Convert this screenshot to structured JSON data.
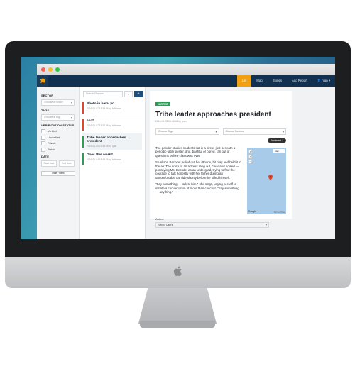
{
  "window": {
    "controls": [
      "close",
      "minimize",
      "zoom"
    ]
  },
  "navbar": {
    "logo_icon": "tree-logo-icon",
    "items": [
      {
        "label": "List",
        "active": true
      },
      {
        "label": "Map",
        "active": false
      },
      {
        "label": "Stories",
        "active": false
      },
      {
        "label": "Add Report",
        "active": false
      },
      {
        "label": "ryan",
        "active": false,
        "icon": "user-icon"
      }
    ]
  },
  "filters": {
    "sector_label": "SECTOR",
    "sector_placeholder": "Choose a Sector",
    "tags_label": "TAGS",
    "tags_placeholder": "Choose a Tag",
    "verification_label": "VERIFICATION STATUS",
    "statuses": [
      "Verified",
      "Unverified",
      "Private",
      "Public"
    ],
    "date_label": "DATE",
    "start_date": "Start date",
    "end_date": "End date",
    "hide_filters": "Hide Filters"
  },
  "reports": {
    "search_placeholder": "Search Reports",
    "add_label": "+",
    "items": [
      {
        "title": "Photo in here, yo",
        "meta": "2016-01-07 15:33:06 by lvilbowaz",
        "color": "#e0462f"
      },
      {
        "title": "asdf",
        "meta": "2016-01-07 15:32:06 by lvilbowaz",
        "color": "#e0462f"
      },
      {
        "title": "Tribe leader approaches president",
        "meta": "2016-01-05 21:48:48 by ryan",
        "color": "#2e9b58"
      },
      {
        "title": "Does this work?",
        "meta": "2016-01-04 18:45:16 by lvilbowaz",
        "color": "#2e9b58"
      }
    ]
  },
  "detail": {
    "status": "Verified",
    "title": "Tribe leader approaches president",
    "meta": "2016-01-05 21:48:48 by ryan",
    "tag_placeholder": "Choose Tags",
    "sector_placeholder": "Choose Sectors",
    "sentiment": "Sentiment 1",
    "paragraphs": [
      "The gender studies students sat in a circle, just beneath a periodic-table poster, and, bashful or bored, ran out of questions before class was over.",
      "So Alison Bechdel pulled out her iPhone, hit play and held it in the air. The voice of an actress rang out, clear and poised — portraying Ms. Bechdel as an undergrad, trying to find the courage to talk honestly with her father during an uncomfortable car ride shortly before he killed himself.",
      "\"Say something — talk to him,\" she sings, urging herself to initiate a conversation of more than chitchat. \"Say something — anything.\""
    ],
    "map_type": "Map",
    "map_brand": "Google",
    "map_terms": "Terms of Use",
    "author_label": "Author",
    "author_value": "Select Users"
  }
}
